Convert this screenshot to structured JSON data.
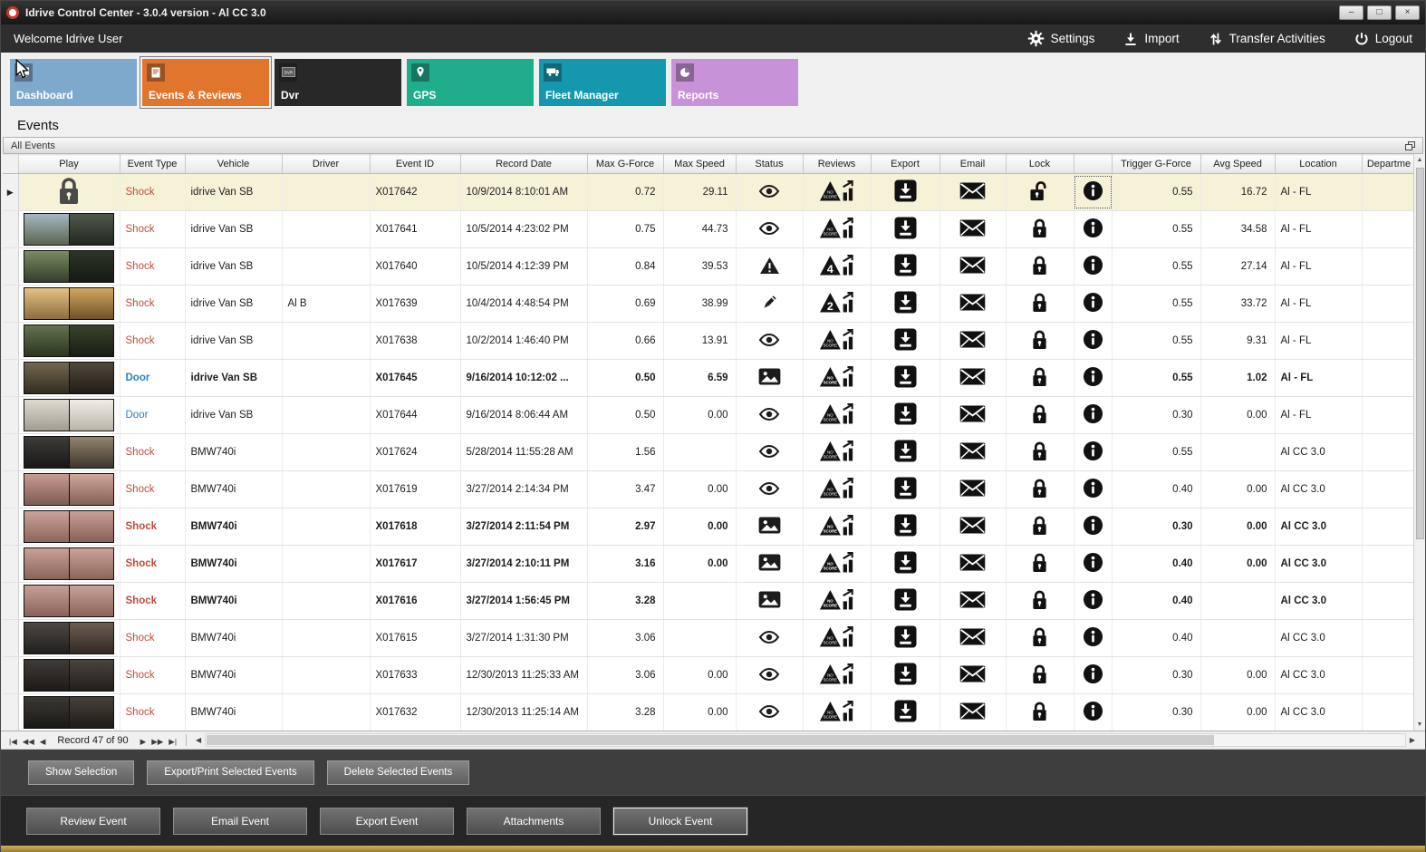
{
  "window": {
    "title": "Idrive Control Center - 3.0.4 version - Al CC 3.0"
  },
  "topbar": {
    "welcome": "Welcome Idrive User",
    "actions": [
      {
        "id": "settings",
        "label": "Settings"
      },
      {
        "id": "import",
        "label": "Import"
      },
      {
        "id": "transfer",
        "label": "Transfer Activities"
      },
      {
        "id": "logout",
        "label": "Logout"
      }
    ]
  },
  "nav_tiles": [
    {
      "id": "dashboard",
      "label": "Dashboard",
      "color": "#7FA8CD",
      "selected": false
    },
    {
      "id": "events",
      "label": "Events & Reviews",
      "color": "#E2752E",
      "selected": true
    },
    {
      "id": "dvr",
      "label": "Dvr",
      "color": "#282828",
      "selected": false
    },
    {
      "id": "gps",
      "label": "GPS",
      "color": "#1FAD8B",
      "selected": false
    },
    {
      "id": "fleet",
      "label": "Fleet Manager",
      "color": "#1598AE",
      "selected": false
    },
    {
      "id": "reports",
      "label": "Reports",
      "color": "#C892D8",
      "selected": false
    }
  ],
  "page": {
    "title": "Events",
    "group_header": "All Events"
  },
  "colors": {
    "shock": "#BE4B3B",
    "door": "#2F7FBF",
    "selected_row_bg": "#F6F2D8"
  },
  "table": {
    "columns": [
      "Play",
      "Event Type",
      "Vehicle",
      "Driver",
      "Event ID",
      "Record Date",
      "Max G-Force",
      "Max Speed",
      "Status",
      "Reviews",
      "Export",
      "Email",
      "Lock",
      "",
      "Trigger G-Force",
      "Avg Speed",
      "Location",
      "Departme"
    ],
    "rows": [
      {
        "thumb": "lock",
        "type": "Shock",
        "type_color": "shock",
        "vehicle": "idrive Van SB",
        "driver": "",
        "event_id": "X017642",
        "record_date": "10/9/2014 8:10:01 AM",
        "max_g": "0.72",
        "max_speed": "29.11",
        "status": "eye",
        "review": "NO SCORE",
        "lock": "unlocked",
        "trigger_g": "0.55",
        "avg_speed": "16.72",
        "location": "Al - FL",
        "bold": false,
        "selected": true
      },
      {
        "thumb": {
          "l": [
            "#A8B8C0",
            "#5A6450"
          ],
          "r": [
            "#50584C",
            "#23281E"
          ]
        },
        "type": "Shock",
        "type_color": "shock",
        "vehicle": "idrive Van SB",
        "driver": "",
        "event_id": "X017641",
        "record_date": "10/5/2014 4:23:02 PM",
        "max_g": "0.75",
        "max_speed": "44.73",
        "status": "eye",
        "review": "NO SCORE",
        "lock": "locked",
        "trigger_g": "0.55",
        "avg_speed": "34.58",
        "location": "Al - FL",
        "bold": false,
        "selected": false
      },
      {
        "thumb": {
          "l": [
            "#7A8A64",
            "#333E28"
          ],
          "r": [
            "#2C3429",
            "#151A13"
          ]
        },
        "type": "Shock",
        "type_color": "shock",
        "vehicle": "idrive Van SB",
        "driver": "",
        "event_id": "X017640",
        "record_date": "10/5/2014 4:12:39 PM",
        "max_g": "0.84",
        "max_speed": "39.53",
        "status": "warning",
        "review": "4",
        "lock": "locked",
        "trigger_g": "0.55",
        "avg_speed": "27.14",
        "location": "Al - FL",
        "bold": false,
        "selected": false
      },
      {
        "thumb": {
          "l": [
            "#E5C184",
            "#8D6C3E"
          ],
          "r": [
            "#D0A95E",
            "#6E5128"
          ]
        },
        "type": "Shock",
        "type_color": "shock",
        "vehicle": "idrive Van SB",
        "driver": "Al B",
        "event_id": "X017639",
        "record_date": "10/4/2014 4:48:54 PM",
        "max_g": "0.69",
        "max_speed": "38.99",
        "status": "pencil",
        "review": "2",
        "lock": "locked",
        "trigger_g": "0.55",
        "avg_speed": "33.72",
        "location": "Al - FL",
        "bold": false,
        "selected": false
      },
      {
        "thumb": {
          "l": [
            "#64724F",
            "#2C351F"
          ],
          "r": [
            "#39422E",
            "#181D12"
          ]
        },
        "type": "Shock",
        "type_color": "shock",
        "vehicle": "idrive Van SB",
        "driver": "",
        "event_id": "X017638",
        "record_date": "10/2/2014 1:46:40 PM",
        "max_g": "0.66",
        "max_speed": "13.91",
        "status": "eye",
        "review": "NO SCORE",
        "lock": "locked",
        "trigger_g": "0.55",
        "avg_speed": "9.31",
        "location": "Al - FL",
        "bold": false,
        "selected": false
      },
      {
        "thumb": {
          "l": [
            "#746750",
            "#322C20"
          ],
          "r": [
            "#52493C",
            "#201C15"
          ]
        },
        "type": "Door",
        "type_color": "door",
        "vehicle": "idrive Van SB",
        "driver": "",
        "event_id": "X017645",
        "record_date": "9/16/2014 10:12:02 ...",
        "max_g": "0.50",
        "max_speed": "6.59",
        "status": "image",
        "review": "NO SCORE",
        "lock": "locked",
        "trigger_g": "0.55",
        "avg_speed": "1.02",
        "location": "Al - FL",
        "bold": true,
        "selected": false
      },
      {
        "thumb": {
          "l": [
            "#DEDCD2",
            "#A09C90"
          ],
          "r": [
            "#F0EEE6",
            "#B8B4A8"
          ]
        },
        "type": "Door",
        "type_color": "door",
        "vehicle": "idrive Van SB",
        "driver": "",
        "event_id": "X017644",
        "record_date": "9/16/2014 8:06:44 AM",
        "max_g": "0.50",
        "max_speed": "0.00",
        "status": "eye",
        "review": "NO SCORE",
        "lock": "locked",
        "trigger_g": "0.30",
        "avg_speed": "0.00",
        "location": "Al - FL",
        "bold": false,
        "selected": false
      },
      {
        "thumb": {
          "l": [
            "#3E3C38",
            "#191817"
          ],
          "r": [
            "#93836E",
            "#3E362C"
          ]
        },
        "type": "Shock",
        "type_color": "shock",
        "vehicle": "BMW740i",
        "driver": "",
        "event_id": "X017624",
        "record_date": "5/28/2014 11:55:28 AM",
        "max_g": "1.56",
        "max_speed": "",
        "status": "eye",
        "review": "NO SCORE",
        "lock": "locked",
        "trigger_g": "0.55",
        "avg_speed": "",
        "location": "Al CC 3.0",
        "bold": false,
        "selected": false
      },
      {
        "thumb": {
          "l": [
            "#C89B91",
            "#7D5C52"
          ],
          "r": [
            "#CFA79B",
            "#826055"
          ]
        },
        "type": "Shock",
        "type_color": "shock",
        "vehicle": "BMW740i",
        "driver": "",
        "event_id": "X017619",
        "record_date": "3/27/2014 2:14:34 PM",
        "max_g": "3.47",
        "max_speed": "0.00",
        "status": "eye",
        "review": "NO SCORE",
        "lock": "locked",
        "trigger_g": "0.40",
        "avg_speed": "0.00",
        "location": "Al CC 3.0",
        "bold": false,
        "selected": false
      },
      {
        "thumb": {
          "l": [
            "#CBA399",
            "#8C655B"
          ],
          "r": [
            "#C89F95",
            "#886158"
          ]
        },
        "type": "Shock",
        "type_color": "shock",
        "vehicle": "BMW740i",
        "driver": "",
        "event_id": "X017618",
        "record_date": "3/27/2014 2:11:54 PM",
        "max_g": "2.97",
        "max_speed": "0.00",
        "status": "image",
        "review": "NO SCORE",
        "lock": "locked",
        "trigger_g": "0.30",
        "avg_speed": "0.00",
        "location": "Al CC 3.0",
        "bold": true,
        "selected": false
      },
      {
        "thumb": {
          "l": [
            "#C9A197",
            "#8A635A"
          ],
          "r": [
            "#CBA399",
            "#8C655B"
          ]
        },
        "type": "Shock",
        "type_color": "shock",
        "vehicle": "BMW740i",
        "driver": "",
        "event_id": "X017617",
        "record_date": "3/27/2014 2:10:11 PM",
        "max_g": "3.16",
        "max_speed": "0.00",
        "status": "image",
        "review": "NO SCORE",
        "lock": "locked",
        "trigger_g": "0.40",
        "avg_speed": "0.00",
        "location": "Al CC 3.0",
        "bold": true,
        "selected": false
      },
      {
        "thumb": {
          "l": [
            "#C7A095",
            "#88625A"
          ],
          "r": [
            "#C9A197",
            "#8A635A"
          ]
        },
        "type": "Shock",
        "type_color": "shock",
        "vehicle": "BMW740i",
        "driver": "",
        "event_id": "X017616",
        "record_date": "3/27/2014 1:56:45 PM",
        "max_g": "3.28",
        "max_speed": "",
        "status": "image",
        "review": "NO SCORE",
        "lock": "locked",
        "trigger_g": "0.40",
        "avg_speed": "",
        "location": "Al CC 3.0",
        "bold": true,
        "selected": false
      },
      {
        "thumb": {
          "l": [
            "#4C4844",
            "#211F1D"
          ],
          "r": [
            "#6E5E52",
            "#322922"
          ]
        },
        "type": "Shock",
        "type_color": "shock",
        "vehicle": "BMW740i",
        "driver": "",
        "event_id": "X017615",
        "record_date": "3/27/2014 1:31:30 PM",
        "max_g": "3.06",
        "max_speed": "",
        "status": "eye",
        "review": "NO SCORE",
        "lock": "locked",
        "trigger_g": "0.40",
        "avg_speed": "",
        "location": "Al CC 3.0",
        "bold": false,
        "selected": false
      },
      {
        "thumb": {
          "l": [
            "#403C38",
            "#1C1A18"
          ],
          "r": [
            "#4A443E",
            "#211E1B"
          ]
        },
        "type": "Shock",
        "type_color": "shock",
        "vehicle": "BMW740i",
        "driver": "",
        "event_id": "X017633",
        "record_date": "12/30/2013 11:25:33 AM",
        "max_g": "3.06",
        "max_speed": "0.00",
        "status": "eye",
        "review": "NO SCORE",
        "lock": "locked",
        "trigger_g": "0.30",
        "avg_speed": "0.00",
        "location": "Al CC 3.0",
        "bold": false,
        "selected": false
      },
      {
        "thumb": {
          "l": [
            "#3C3834",
            "#1A1816"
          ],
          "r": [
            "#464039",
            "#1F1C19"
          ]
        },
        "type": "Shock",
        "type_color": "shock",
        "vehicle": "BMW740i",
        "driver": "",
        "event_id": "X017632",
        "record_date": "12/30/2013 11:25:14 AM",
        "max_g": "3.28",
        "max_speed": "0.00",
        "status": "eye",
        "review": "NO SCORE",
        "lock": "locked",
        "trigger_g": "0.30",
        "avg_speed": "0.00",
        "location": "Al CC 3.0",
        "bold": false,
        "selected": false
      }
    ]
  },
  "pager": {
    "text": "Record 47 of 90",
    "left_icons": [
      "|◀",
      "◀◀",
      "◀"
    ],
    "right_icons": [
      "▶",
      "▶▶",
      "▶|"
    ]
  },
  "selection_buttons": [
    {
      "id": "show-selection-button",
      "label": "Show Selection"
    },
    {
      "id": "export-print-button",
      "label": "Export/Print Selected Events"
    },
    {
      "id": "delete-selected-button",
      "label": "Delete Selected  Events"
    }
  ],
  "event_buttons": [
    {
      "id": "review-event-button",
      "label": "Review Event",
      "focused": false
    },
    {
      "id": "email-event-button",
      "label": "Email Event",
      "focused": false
    },
    {
      "id": "export-event-button",
      "label": "Export Event",
      "focused": false
    },
    {
      "id": "attachments-button",
      "label": "Attachments",
      "focused": false
    },
    {
      "id": "unlock-event-button",
      "label": "Unlock Event",
      "focused": true
    }
  ]
}
